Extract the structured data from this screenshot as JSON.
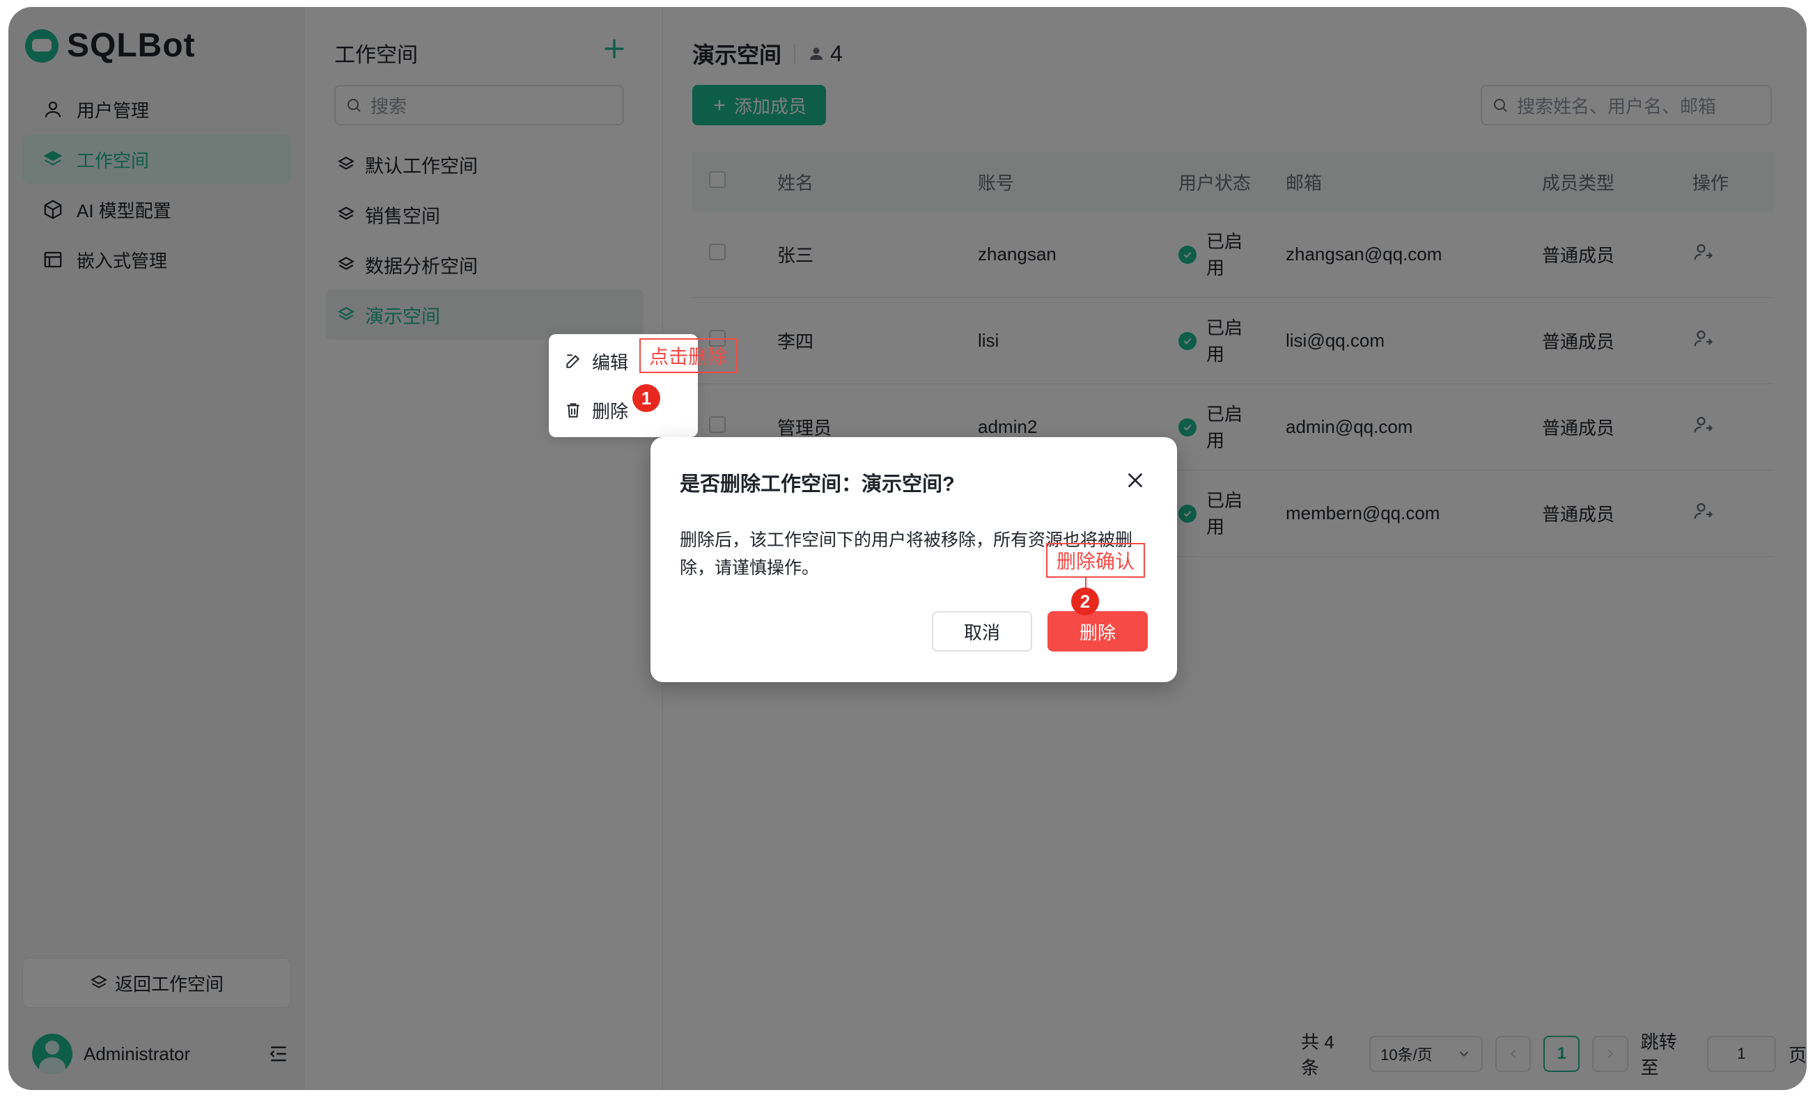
{
  "app": {
    "name": "SQLBot"
  },
  "sidebar": {
    "items": [
      {
        "label": "用户管理",
        "icon": "user-icon"
      },
      {
        "label": "工作空间",
        "icon": "layers-icon",
        "active": true
      },
      {
        "label": "AI 模型配置",
        "icon": "cube-icon"
      },
      {
        "label": "嵌入式管理",
        "icon": "embed-icon"
      }
    ],
    "back_label": "返回工作空间",
    "user_name": "Administrator"
  },
  "workspaces": {
    "title": "工作空间",
    "search_placeholder": "搜索",
    "items": [
      "默认工作空间",
      "销售空间",
      "数据分析空间",
      "演示空间"
    ],
    "active_index": 3
  },
  "context_menu": {
    "edit": "编辑",
    "delete": "删除"
  },
  "main": {
    "title": "演示空间",
    "member_count": "4",
    "add_member": "添加成员",
    "search_placeholder": "搜索姓名、用户名、邮箱",
    "columns": {
      "name": "姓名",
      "account": "账号",
      "status": "用户状态",
      "email": "邮箱",
      "type": "成员类型",
      "op": "操作"
    },
    "rows": [
      {
        "name": "张三",
        "account": "zhangsan",
        "status": "已启用",
        "email": "zhangsan@qq.com",
        "type": "普通成员"
      },
      {
        "name": "李四",
        "account": "lisi",
        "status": "已启用",
        "email": "lisi@qq.com",
        "type": "普通成员"
      },
      {
        "name": "管理员",
        "account": "admin2",
        "status": "已启用",
        "email": "admin@qq.com",
        "type": "普通成员"
      },
      {
        "name": "",
        "account": "",
        "status": "已启用",
        "email": "membern@qq.com",
        "type": "普通成员"
      }
    ],
    "pager": {
      "total": "共 4 条",
      "page_size": "10条/页",
      "current": "1",
      "jump_label": "跳转至",
      "jump_value": "1",
      "page_unit": "页"
    }
  },
  "dialog": {
    "title": "是否删除工作空间：演示空间?",
    "body": "删除后，该工作空间下的用户将被移除，所有资源也将被删除，请谨慎操作。",
    "cancel": "取消",
    "confirm": "删除"
  },
  "annotations": {
    "step1_label": "点击删除",
    "step1_num": "1",
    "step2_label": "删除确认",
    "step2_num": "2"
  },
  "colors": {
    "accent": "#1cba90",
    "danger": "#f54a45",
    "annotation": "#e8281f"
  }
}
